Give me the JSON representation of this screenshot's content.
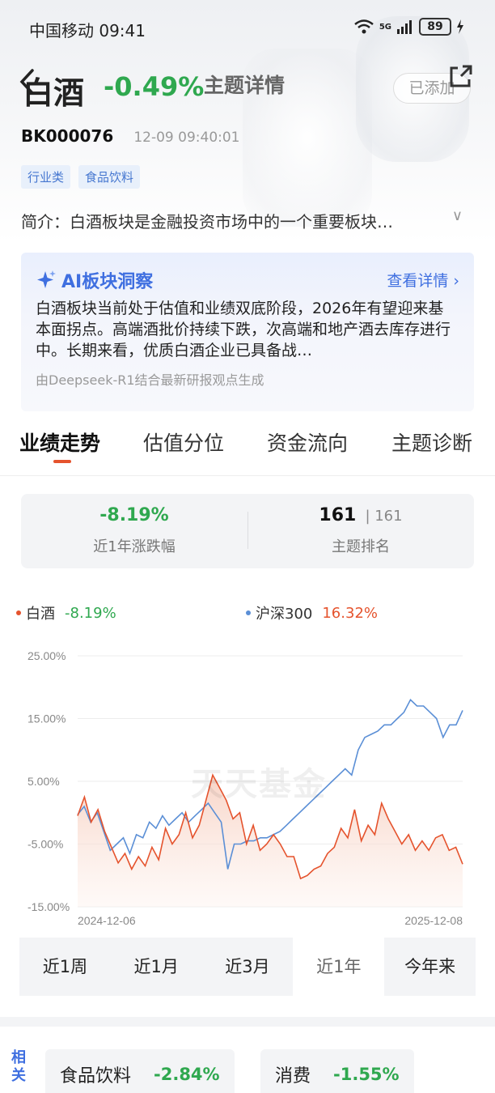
{
  "status_bar": {
    "carrier_time": "中国移动 09:41",
    "network": "5G",
    "battery": "89"
  },
  "header": {
    "title": "白酒",
    "change_pct": "-0.49%",
    "subtitle": "主题详情",
    "added_label": "已添加"
  },
  "info": {
    "code": "BK000076",
    "timestamp": "12-09 09:40:01",
    "tags": [
      "行业类",
      "食品饮料"
    ],
    "intro": "简介：白酒板块是金融投资市场中的一个重要板块…"
  },
  "ai_card": {
    "title": "AI板块洞察",
    "link": "查看详情",
    "text": "白酒板块当前处于估值和业绩双底阶段，2026年有望迎来基本面拐点。高端酒批价持续下跌，次高端和地产酒去库存进行中。长期来看，优质白酒企业已具备战…",
    "footer": "由Deepseek-R1结合最新研报观点生成"
  },
  "tabs": [
    "业绩走势",
    "估值分位",
    "资金流向",
    "主题诊断"
  ],
  "summary": {
    "change_value": "-8.19%",
    "change_label": "近1年涨跌幅",
    "rank": "161",
    "rank_total": "161",
    "rank_label": "主题排名"
  },
  "legend": {
    "series1_name": "白酒",
    "series1_value": "-8.19%",
    "series2_name": "沪深300",
    "series2_value": "16.32%"
  },
  "chart_data": {
    "type": "area",
    "watermark": "天天基金",
    "yticks": [
      "25.00%",
      "15.00%",
      "5.00%",
      "-5.00%",
      "-15.00%"
    ],
    "ylim": [
      -15,
      25
    ],
    "x_start_label": "2024-12-06",
    "x_end_label": "2025-12-08",
    "series": [
      {
        "name": "白酒",
        "color": "#e5532d",
        "values": [
          -0.5,
          2.5,
          -1.5,
          0.5,
          -3,
          -5.5,
          -8,
          -6.5,
          -9,
          -7,
          -8.5,
          -5.5,
          -7.5,
          -2.5,
          -5,
          -3.5,
          0,
          -4,
          -2,
          2,
          6,
          4,
          2,
          -1,
          0,
          -5,
          -2,
          -6,
          -5,
          -3.5,
          -5,
          -7,
          -7,
          -10.5,
          -10,
          -9,
          -8.5,
          -6.5,
          -5.5,
          -2.5,
          -4,
          0.5,
          -4.5,
          -2,
          -3.5,
          1.5,
          -1,
          -3,
          -5,
          -3.5,
          -6,
          -4.5,
          -6,
          -4,
          -3.5,
          -6,
          -5.5,
          -8.2
        ]
      },
      {
        "name": "沪深300",
        "color": "#5b8fd6",
        "values": [
          -0.3,
          1,
          -1.5,
          0,
          -3,
          -6,
          -5,
          -4,
          -6.5,
          -3.5,
          -4,
          -1.5,
          -2.5,
          -0.5,
          -2,
          -1,
          0,
          -1.5,
          -0.5,
          0.5,
          1.5,
          0,
          -1.5,
          -9,
          -5,
          -5,
          -4.5,
          -4.5,
          -4,
          -4,
          -3.5,
          -3,
          -2,
          -1,
          0,
          1,
          2,
          3,
          4,
          5,
          6,
          7,
          6,
          10,
          12,
          12.5,
          13,
          14,
          14,
          15,
          16,
          18,
          17,
          17,
          16,
          15,
          12,
          14,
          14,
          16.3
        ]
      }
    ]
  },
  "ranges": [
    "近1周",
    "近1月",
    "近3月",
    "近1年",
    "今年来"
  ],
  "active_range": "近1年",
  "related": {
    "label": "相关",
    "items": [
      {
        "name": "食品饮料",
        "pct": "-2.84%"
      },
      {
        "name": "消费",
        "pct": "-1.55%"
      }
    ]
  },
  "colors": {
    "down": "#2fa84f",
    "up": "#e5532d",
    "accent_blue": "#3f6fe0"
  }
}
